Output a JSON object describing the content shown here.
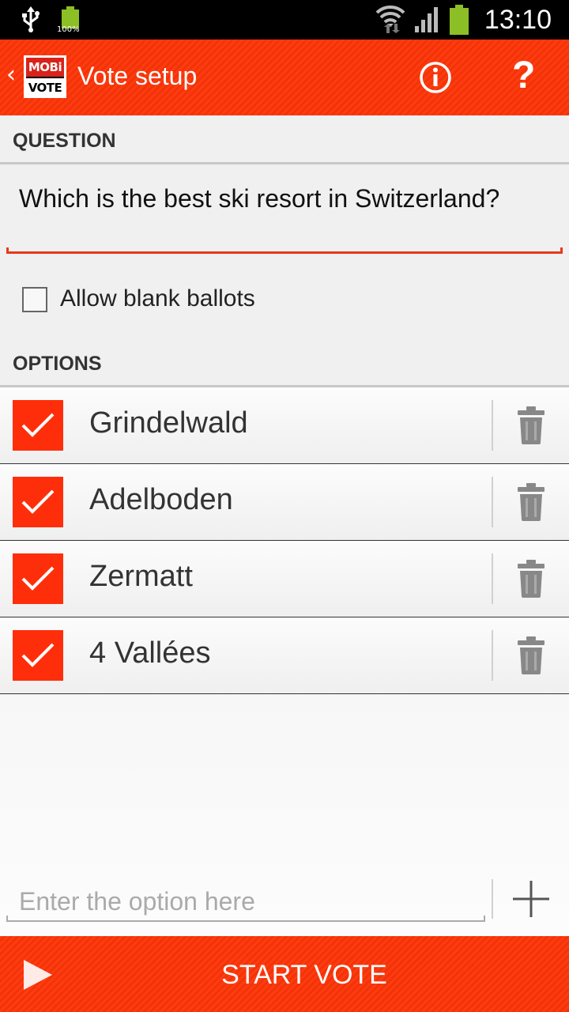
{
  "status_bar": {
    "battery_small_label": "100%",
    "time": "13:10"
  },
  "action_bar": {
    "logo_top": "MOBi",
    "logo_bottom": "VOTE",
    "title": "Vote setup"
  },
  "question_section": {
    "header": "QUESTION",
    "text": "Which is the best ski resort in Switzerland?"
  },
  "blank_ballots": {
    "label": "Allow blank ballots",
    "checked": false
  },
  "options_section": {
    "header": "OPTIONS",
    "items": [
      {
        "label": "Grindelwald",
        "checked": true
      },
      {
        "label": "Adelboden",
        "checked": true
      },
      {
        "label": "Zermatt",
        "checked": true
      },
      {
        "label": "4 Vallées",
        "checked": true
      }
    ]
  },
  "new_option": {
    "placeholder": "Enter the option here"
  },
  "start_vote": {
    "label": "START VOTE"
  },
  "colors": {
    "accent": "#ff3b10",
    "checkbox": "#ff2e0a",
    "underline": "#e8381f"
  }
}
